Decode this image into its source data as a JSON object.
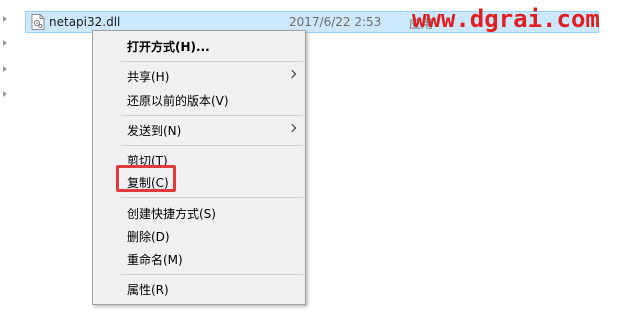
{
  "file": {
    "name": "netapi32.dll",
    "date": "2017/6/22 2:53",
    "type": "应用"
  },
  "watermark": "www.dgrai.com",
  "context_menu": {
    "items": [
      {
        "label": "打开方式(H)..."
      },
      {
        "label": "共享(H)",
        "submenu": true
      },
      {
        "label": "还原以前的版本(V)"
      },
      {
        "label": "发送到(N)",
        "submenu": true
      },
      {
        "label": "剪切(T)"
      },
      {
        "label": "复制(C)"
      },
      {
        "label": "创建快捷方式(S)"
      },
      {
        "label": "删除(D)"
      },
      {
        "label": "重命名(M)"
      },
      {
        "label": "属性(R)"
      }
    ]
  },
  "colors": {
    "selection": "#cce8ff",
    "highlight_border": "#e03c3c",
    "watermark": "#e02020",
    "menu_background": "#f0f0f0"
  }
}
